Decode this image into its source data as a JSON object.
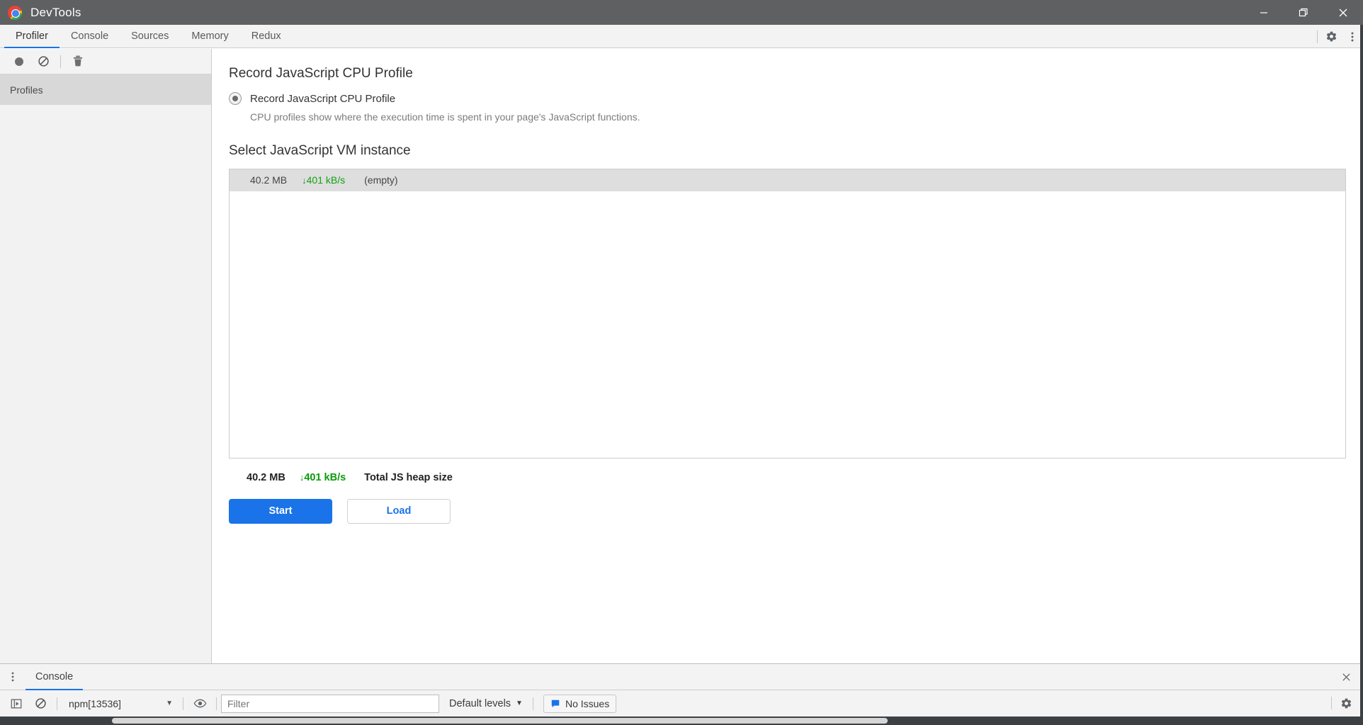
{
  "titlebar": {
    "app_title": "DevTools",
    "logo_icon": "chrome-logo-icon",
    "minimize_label": "—",
    "restore_label": "❐",
    "close_label": "✕"
  },
  "tabs": [
    {
      "label": "Profiler",
      "active": true
    },
    {
      "label": "Console",
      "active": false
    },
    {
      "label": "Sources",
      "active": false
    },
    {
      "label": "Memory",
      "active": false
    },
    {
      "label": "Redux",
      "active": false
    }
  ],
  "tabstrip_actions": {
    "settings_icon": "gear-icon",
    "more_icon": "kebab-menu-icon"
  },
  "sidebar": {
    "toolbar": {
      "record_icon": "record-circle-icon",
      "clear_icon": "no-entry-icon",
      "delete_icon": "trash-icon"
    },
    "section_header": "Profiles",
    "items": []
  },
  "main": {
    "record_section": {
      "title": "Record JavaScript CPU Profile",
      "radio_label": "Record JavaScript CPU Profile",
      "radio_selected": true,
      "description": "CPU profiles show where the execution time is spent in your page's JavaScript functions."
    },
    "vm_section": {
      "title": "Select JavaScript VM instance",
      "rows": [
        {
          "size": "40.2 MB",
          "rate_arrow": "↓",
          "rate": "401 kB/s",
          "name": "(empty)",
          "selected": true
        }
      ]
    },
    "heap_summary": {
      "size": "40.2 MB",
      "rate_arrow": "↓",
      "rate": "401 kB/s",
      "label": "Total JS heap size"
    },
    "buttons": {
      "start_label": "Start",
      "load_label": "Load"
    }
  },
  "drawer": {
    "more_icon": "kebab-menu-icon",
    "tabs": [
      {
        "label": "Console",
        "active": true
      }
    ],
    "close_icon": "close-icon",
    "console_toolbar": {
      "sidebar_toggle_icon": "show-console-sidebar-icon",
      "clear_icon": "no-entry-icon",
      "context_value": "npm[13536]",
      "context_caret": "▼",
      "eye_icon": "eye-icon",
      "filter_placeholder": "Filter",
      "filter_value": "",
      "levels_label": "Default levels",
      "levels_caret": "▼",
      "issues_icon": "message-icon",
      "issues_label": "No Issues",
      "settings_icon": "gear-icon"
    }
  },
  "colors": {
    "accent_blue": "#1a73e8",
    "titlebar_bg": "#5f6061",
    "toolbar_bg": "#f3f3f3",
    "sidebar_bg": "#f2f2f2",
    "profiles_header_bg": "#d8d8d8",
    "row_selected_bg": "#dedede",
    "rate_green": "#12a112",
    "bottom_bar": "#3c4043"
  }
}
